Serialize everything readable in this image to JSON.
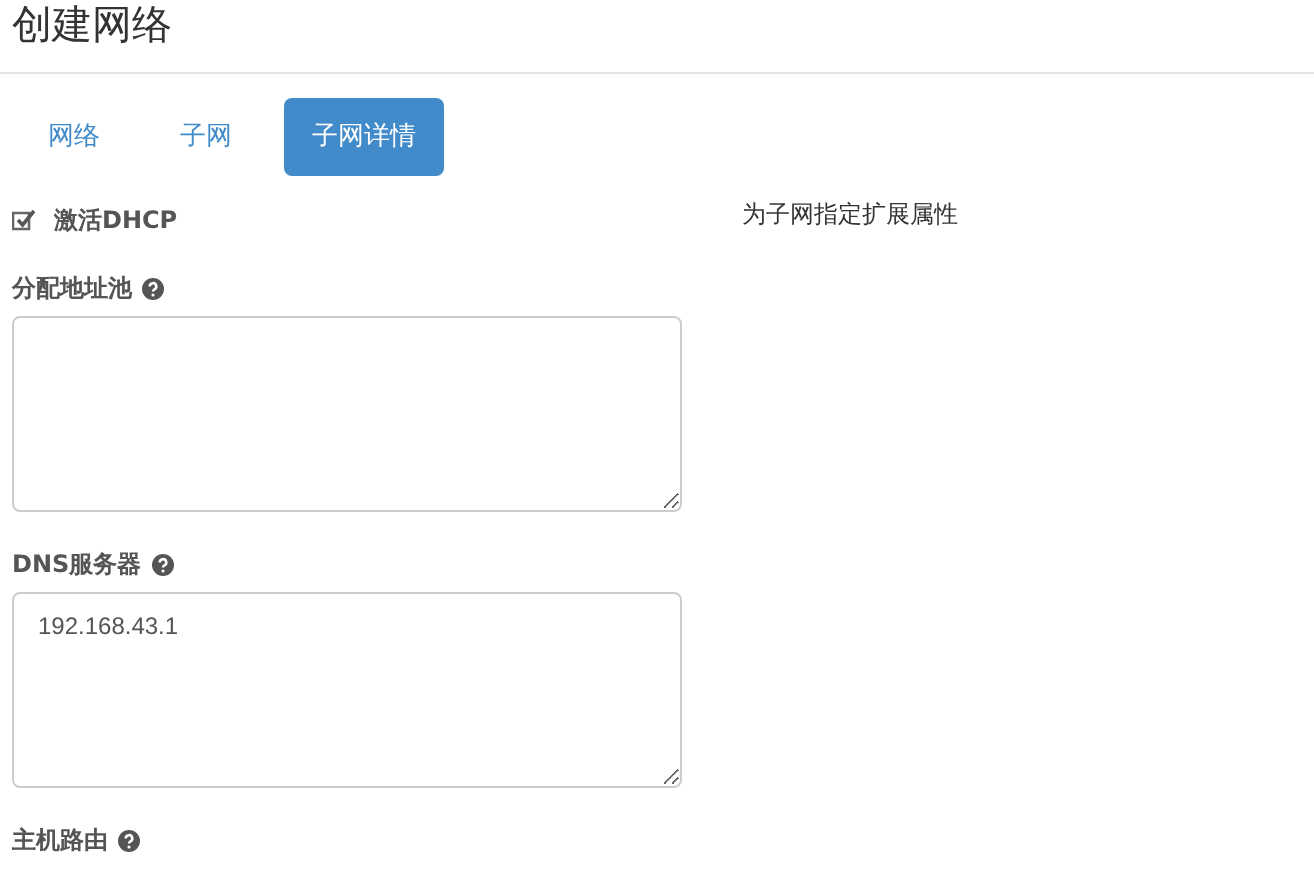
{
  "title": "创建网络",
  "tabs": [
    {
      "label": "网络",
      "selected": false
    },
    {
      "label": "子网",
      "selected": false
    },
    {
      "label": "子网详情",
      "selected": true
    }
  ],
  "dhcp": {
    "label": "激活DHCP",
    "checked": true
  },
  "fields": [
    {
      "kind": "textarea",
      "label": "分配地址池"
    },
    {
      "kind": "textarea",
      "label": "DNS服务器",
      "value": "192.168.43.1"
    },
    {
      "kind": "label",
      "label": "主机路由"
    }
  ],
  "help_text": "为子网指定扩展属性"
}
